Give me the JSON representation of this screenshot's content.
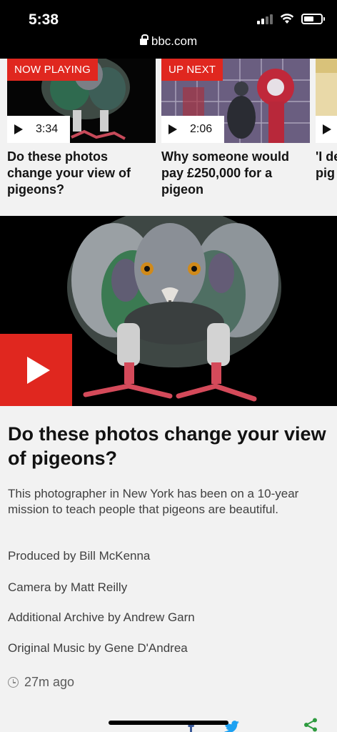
{
  "status_bar": {
    "time": "5:38"
  },
  "browser": {
    "url": "bbc.com"
  },
  "carousel": {
    "items": [
      {
        "badge": "NOW PLAYING",
        "duration": "3:34",
        "title": "Do these photos change your view of pigeons?"
      },
      {
        "badge": "UP NEXT",
        "duration": "2:06",
        "title": "Why someone would pay £250,000 for a pigeon"
      },
      {
        "badge": "",
        "duration": "",
        "title": "'I de pig"
      }
    ]
  },
  "article": {
    "headline": "Do these photos change your view of pigeons?",
    "summary": "This photographer in New York has been on a 10-year mission to teach people that pigeons are beautiful.",
    "credits": [
      "Produced by Bill McKenna",
      "Camera by Matt Reilly",
      "Additional Archive by Andrew Garn",
      "Original Music by Gene D'Andrea"
    ],
    "timestamp": "27m ago"
  },
  "colors": {
    "accent": "#e0271f",
    "background": "#f2f2f2"
  }
}
